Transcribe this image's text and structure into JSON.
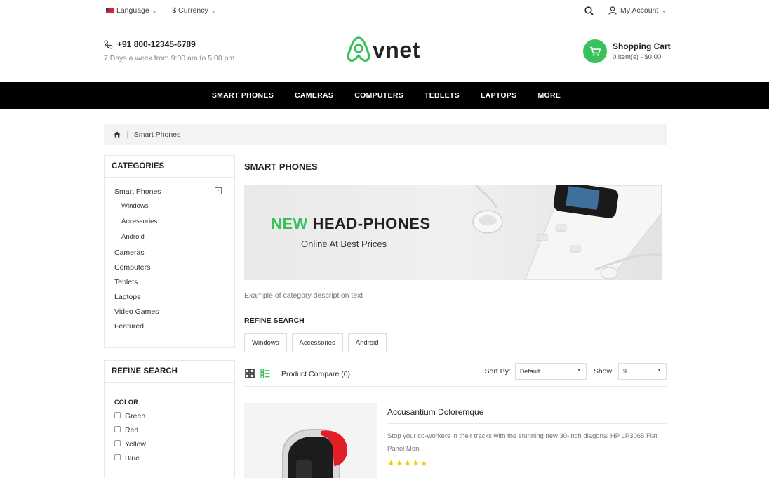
{
  "topbar": {
    "language": "Language",
    "currency": "$ Currency",
    "account": "My Account"
  },
  "header": {
    "phone": "+91 800-12345-6789",
    "hours": "7 Days a week from 9:00 am to 5:00 pm",
    "logo_text": "vnet",
    "cart_title": "Shopping Cart",
    "cart_summary": "0 item(s) - $0.00",
    "accent_color": "#39c25b"
  },
  "nav": {
    "items": [
      "SMART PHONES",
      "CAMERAS",
      "COMPUTERS",
      "TEBLETS",
      "LAPTOPS",
      "MORE"
    ]
  },
  "breadcrumb": {
    "current": "Smart Phones"
  },
  "sidebar": {
    "categories_title": "CATEGORIES",
    "categories": {
      "smart_phones": "Smart Phones",
      "windows": "Windows",
      "accessories": "Accessories",
      "android": "Android",
      "cameras": "Cameras",
      "computers": "Computers",
      "teblets": "Teblets",
      "laptops": "Laptops",
      "video_games": "Video Games",
      "featured": "Featured"
    },
    "refine_title": "REFINE SEARCH",
    "color_title": "COLOR",
    "colors": [
      "Green",
      "Red",
      "Yellow",
      "Blue"
    ]
  },
  "main": {
    "title": "SMART PHONES",
    "banner_new": "NEW",
    "banner_headline": "HEAD-PHONES",
    "banner_tagline": "Online At Best Prices",
    "description": "Example of category description text",
    "refine_title": "REFINE SEARCH",
    "refine_chips": [
      "Windows",
      "Accessories",
      "Android"
    ],
    "compare": "Product Compare (0)",
    "sort_label": "Sort By:",
    "sort_value": "Default",
    "show_label": "Show:",
    "show_value": "9",
    "product": {
      "name": "Accusantium Doloremque",
      "description": "Stop your co-workers in their tracks with the stunning new 30-inch diagonal HP LP3065 Flat Panel Mon..",
      "rating": 5,
      "stars": "★★★★★"
    }
  }
}
